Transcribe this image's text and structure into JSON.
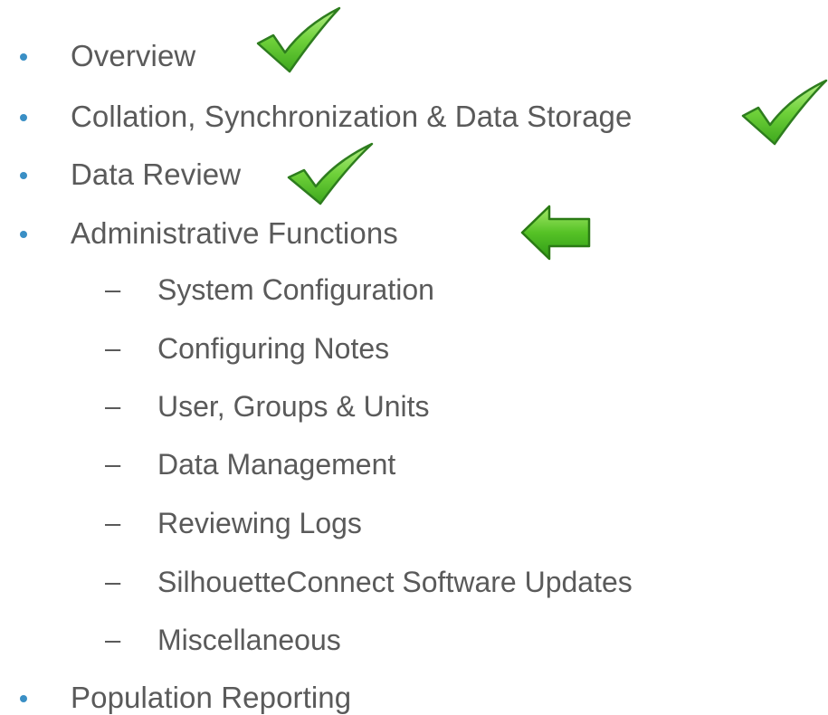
{
  "outline": {
    "items": [
      {
        "label": "Overview",
        "level": 1,
        "status": "done"
      },
      {
        "label": "Collation, Synchronization & Data Storage",
        "level": 1,
        "status": "done"
      },
      {
        "label": "Data Review",
        "level": 1,
        "status": "done"
      },
      {
        "label": "Administrative Functions",
        "level": 1,
        "status": "current"
      },
      {
        "label": "System Configuration",
        "level": 2
      },
      {
        "label": "Configuring Notes",
        "level": 2
      },
      {
        "label": "User, Groups & Units",
        "level": 2
      },
      {
        "label": "Data Management",
        "level": 2
      },
      {
        "label": "Reviewing Logs",
        "level": 2
      },
      {
        "label": "SilhouetteConnect Software Updates",
        "level": 2
      },
      {
        "label": "Miscellaneous",
        "level": 2
      },
      {
        "label": "Population Reporting",
        "level": 1
      }
    ],
    "bullet_glyph": "•",
    "sub_bullet_glyph": "–"
  },
  "icons": {
    "done": "checkmark-icon",
    "current": "arrow-left-icon"
  },
  "colors": {
    "text": "#5a5a5a",
    "bullet": "#3a8fc5",
    "check_fill": "#6fd13a",
    "check_stroke": "#2e7d1e",
    "arrow_fill": "#5cc42a"
  }
}
